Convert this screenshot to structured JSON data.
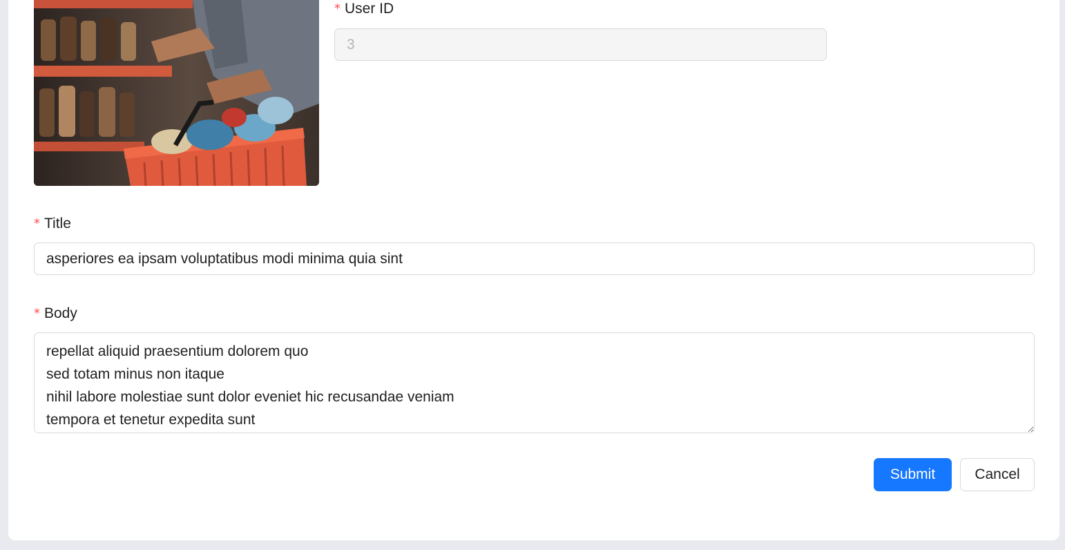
{
  "form": {
    "user_id": {
      "label": "User ID",
      "required_mark": "*",
      "value": "3"
    },
    "title": {
      "label": "Title",
      "required_mark": "*",
      "value": "asperiores ea ipsam voluptatibus modi minima quia sint"
    },
    "body": {
      "label": "Body",
      "required_mark": "*",
      "value": "repellat aliquid praesentium dolorem quo\nsed totam minus non itaque\nnihil labore molestiae sunt dolor eveniet hic recusandae veniam\ntempora et tenetur expedita sunt"
    },
    "actions": {
      "submit_label": "Submit",
      "cancel_label": "Cancel"
    }
  },
  "colors": {
    "accent": "#1677ff",
    "required": "#ff4d4f",
    "page_bg": "#e8eaef"
  }
}
